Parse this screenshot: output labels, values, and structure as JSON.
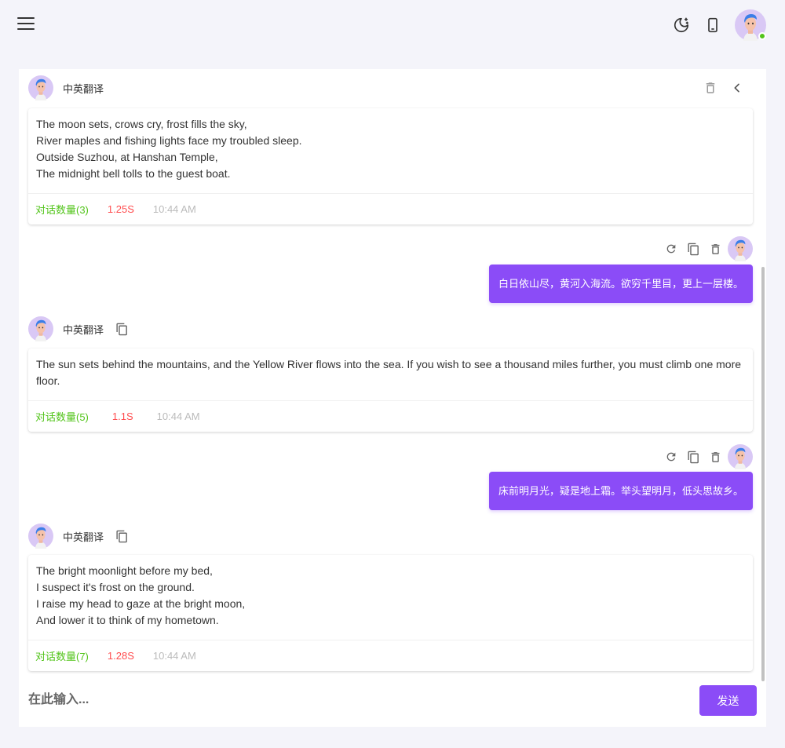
{
  "header": {
    "menu_icon": "menu-icon",
    "theme_icon": "moon-stars-icon",
    "device_icon": "mobile-icon",
    "avatar_status_color": "#52c41a"
  },
  "chat": {
    "title_bot": "中英翻译",
    "accent_color": "#8b4cf7",
    "messages": [
      {
        "role": "bot",
        "lines": [
          "The moon sets, crows cry, frost fills the sky,",
          "River maples and fishing lights face my troubled sleep.",
          "Outside Suzhou, at Hanshan Temple,",
          "The midnight bell tolls to the guest boat."
        ],
        "count": "对话数量(3)",
        "duration": "1.25S",
        "time": "10:44 AM"
      },
      {
        "role": "user",
        "text": "白日依山尽，黄河入海流。欲穷千里目，更上一层楼。"
      },
      {
        "role": "bot",
        "name": "中英翻译",
        "lines": [
          "The sun sets behind the mountains, and the Yellow River flows into the sea. If you wish to see a thousand miles further, you must climb one more floor."
        ],
        "count": "对话数量(5)",
        "duration": "1.1S",
        "time": "10:44 AM"
      },
      {
        "role": "user",
        "text": "床前明月光，疑是地上霜。举头望明月，低头思故乡。"
      },
      {
        "role": "bot",
        "name": "中英翻译",
        "lines": [
          "The bright moonlight before my bed,",
          "I suspect it's frost on the ground.",
          "I raise my head to gaze at the bright moon,",
          "And lower it to think of my hometown."
        ],
        "count": "对话数量(7)",
        "duration": "1.28S",
        "time": "10:44 AM"
      }
    ]
  },
  "composer": {
    "placeholder": "在此输入...",
    "send_label": "发送"
  }
}
